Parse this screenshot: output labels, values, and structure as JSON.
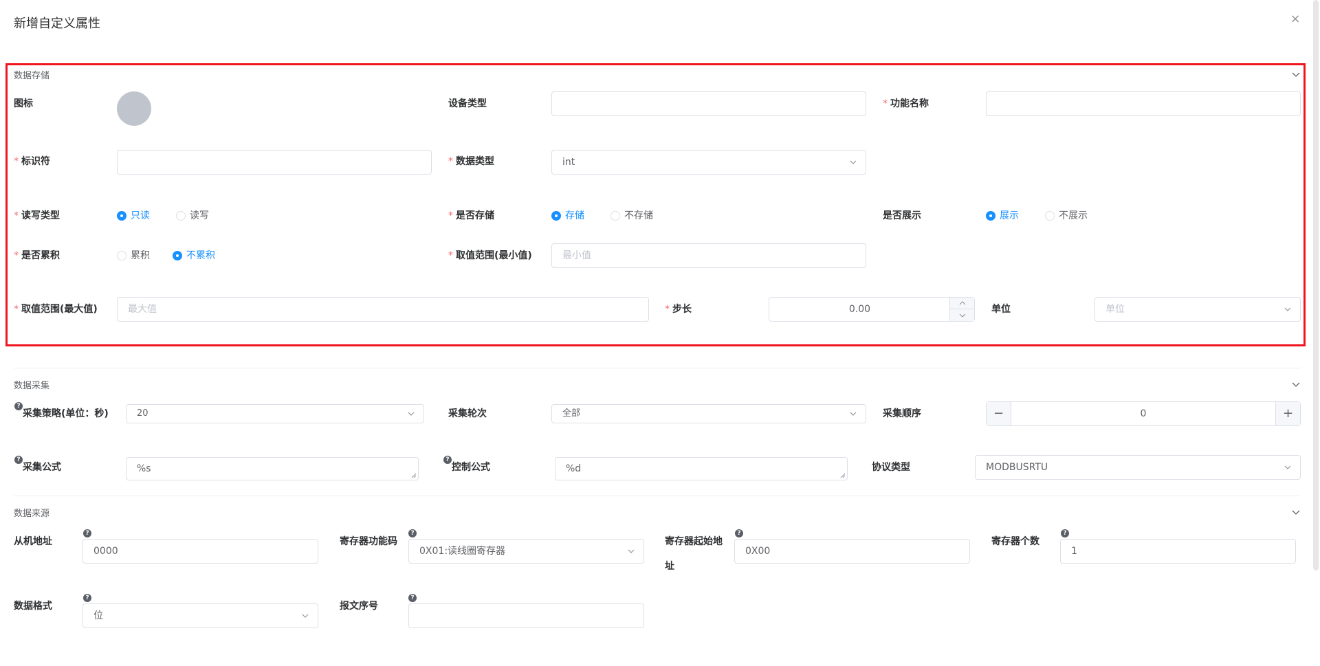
{
  "dialog": {
    "title": "新增自定义属性",
    "close": "×"
  },
  "storage": {
    "section_title": "数据存储",
    "icon_label": "图标",
    "device_type_label": "设备类型",
    "device_type_value": "",
    "function_name_label": "功能名称",
    "function_name_value": "",
    "identifier_label": "标识符",
    "identifier_value": "",
    "data_type_label": "数据类型",
    "data_type_value": "int",
    "rw_label": "读写类型",
    "rw_options": [
      "只读",
      "读写"
    ],
    "rw_selected": "只读",
    "store_label": "是否存储",
    "store_options": [
      "存储",
      "不存储"
    ],
    "store_selected": "存储",
    "show_label": "是否展示",
    "show_options": [
      "展示",
      "不展示"
    ],
    "show_selected": "展示",
    "accum_label": "是否累积",
    "accum_options": [
      "累积",
      "不累积"
    ],
    "accum_selected": "不累积",
    "min_label": "取值范围(最小值)",
    "min_placeholder": "最小值",
    "max_label": "取值范围(最大值)",
    "max_placeholder": "最大值",
    "step_label": "步长",
    "step_value": "0.00",
    "unit_label": "单位",
    "unit_placeholder": "单位"
  },
  "collect": {
    "section_title": "数据采集",
    "strategy_label": "采集策略(单位：秒)",
    "strategy_value": "20",
    "round_label": "采集轮次",
    "round_value": "全部",
    "order_label": "采集顺序",
    "order_value": "0",
    "minus": "−",
    "plus": "+",
    "formula_label": "采集公式",
    "formula_value": "%s",
    "control_label": "控制公式",
    "control_value": "%d",
    "protocol_label": "协议类型",
    "protocol_value": "MODBUSRTU"
  },
  "source": {
    "section_title": "数据来源",
    "slave_label": "从机地址",
    "slave_value": "0000",
    "func_code_label": "寄存器功能码",
    "func_code_value": "0X01:读线圈寄存器",
    "start_addr_label_1": "寄存器起始地",
    "start_addr_label_2": "址",
    "start_addr_value": "0X00",
    "count_label": "寄存器个数",
    "count_value": "1",
    "format_label": "数据格式",
    "format_value": "位",
    "seq_label": "报文序号",
    "seq_value": ""
  },
  "help_glyph": "?",
  "required_mark": "*"
}
